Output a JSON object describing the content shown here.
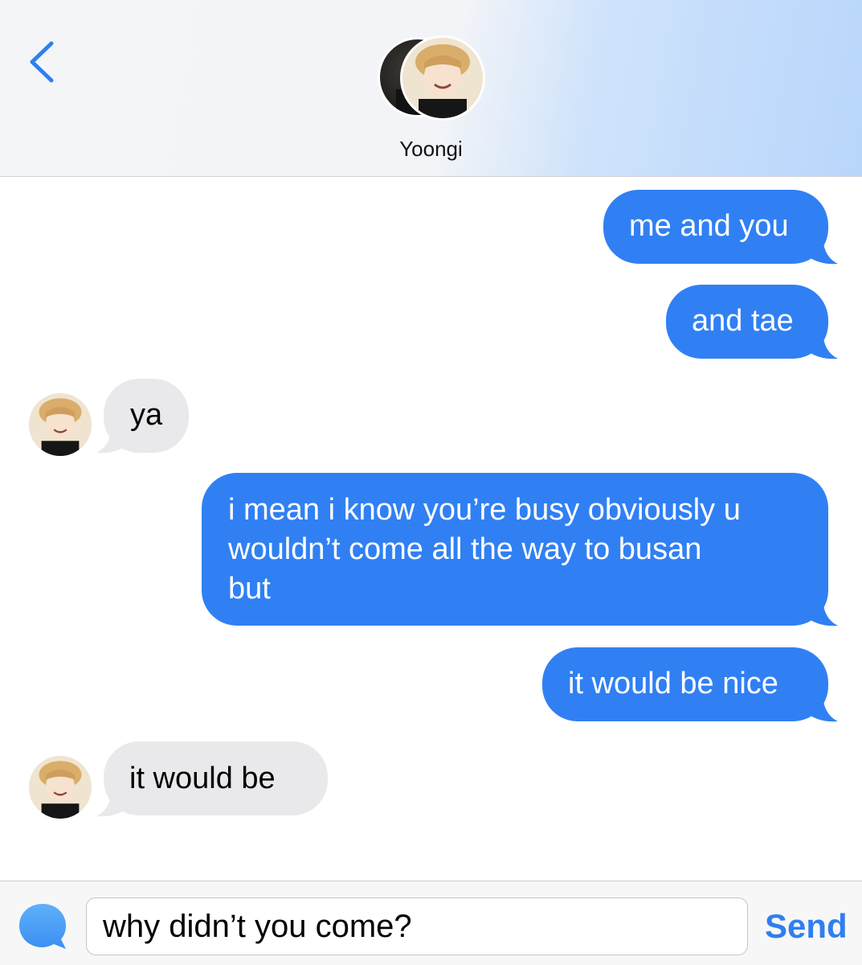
{
  "header": {
    "back_icon": "chevron-left-icon",
    "contact_name": "Yoongi"
  },
  "messages": [
    {
      "side": "sent",
      "text": "me and you"
    },
    {
      "side": "sent",
      "text": "and tae"
    },
    {
      "side": "received",
      "text": "ya"
    },
    {
      "side": "sent",
      "lines": [
        "i mean i know you’re busy obviously u",
        "wouldn’t come all the way to busan",
        "but"
      ]
    },
    {
      "side": "sent",
      "text": "it would be nice"
    },
    {
      "side": "received",
      "text": "it would be"
    }
  ],
  "composer": {
    "app_icon": "speech-bubble-icon",
    "input_value": "why didn’t you come?",
    "send_label": "Send"
  },
  "colors": {
    "sent_bubble": "#3080f4",
    "received_bubble": "#e9e9eb",
    "accent": "#2f7ff0"
  }
}
